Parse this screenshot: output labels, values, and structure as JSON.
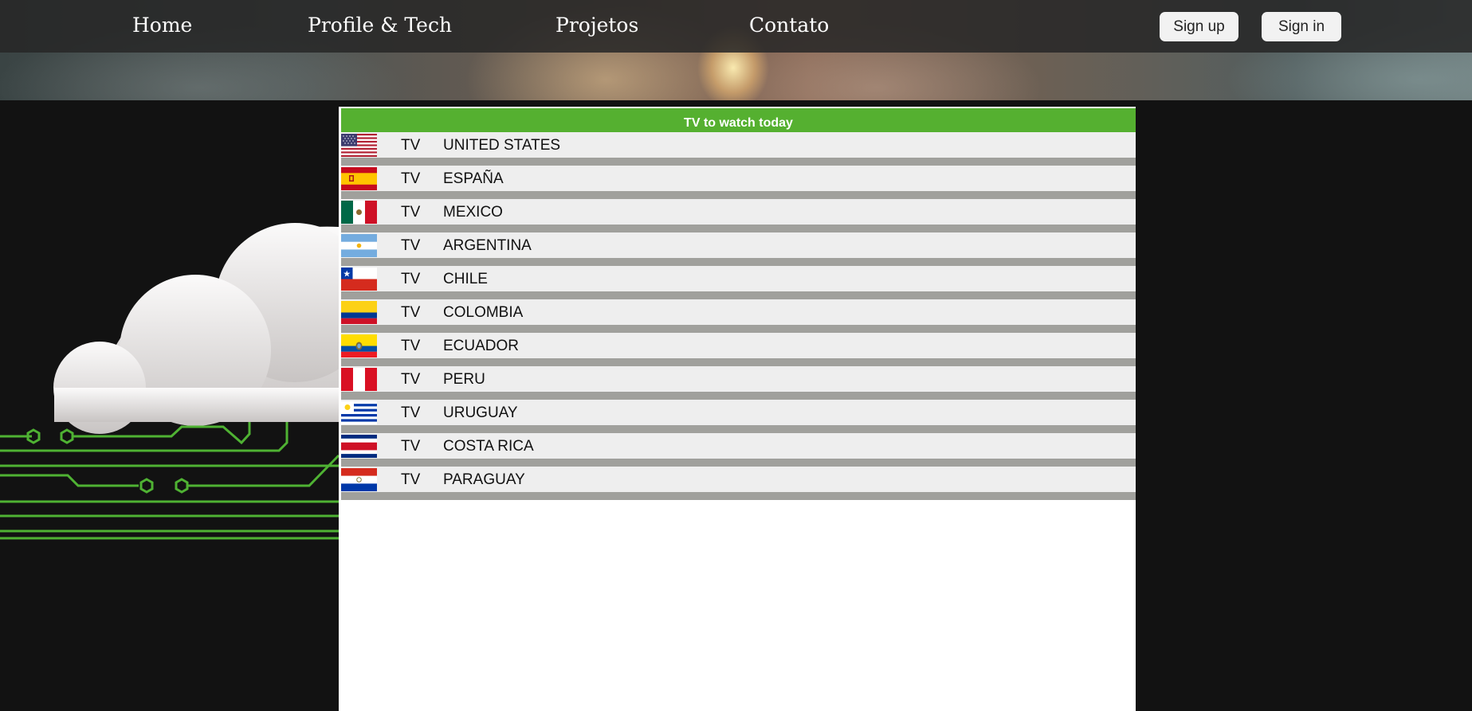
{
  "nav": {
    "links": [
      "Home",
      "Profile & Tech",
      "Projetos",
      "Contato"
    ],
    "signup_label": "Sign up",
    "signin_label": "Sign in"
  },
  "table": {
    "title": "TV to watch today",
    "rows": [
      {
        "channel": "TV",
        "country": "UNITED STATES",
        "flag_icon": "us-flag-icon"
      },
      {
        "channel": "TV",
        "country": "ESPAÑA",
        "flag_icon": "spain-flag-icon"
      },
      {
        "channel": "TV",
        "country": "MEXICO",
        "flag_icon": "mexico-flag-icon"
      },
      {
        "channel": "TV",
        "country": "ARGENTINA",
        "flag_icon": "argentina-flag-icon"
      },
      {
        "channel": "TV",
        "country": "CHILE",
        "flag_icon": "chile-flag-icon"
      },
      {
        "channel": "TV",
        "country": "COLOMBIA",
        "flag_icon": "colombia-flag-icon"
      },
      {
        "channel": "TV",
        "country": "ECUADOR",
        "flag_icon": "ecuador-flag-icon"
      },
      {
        "channel": "TV",
        "country": "PERU",
        "flag_icon": "peru-flag-icon"
      },
      {
        "channel": "TV",
        "country": "URUGUAY",
        "flag_icon": "uruguay-flag-icon"
      },
      {
        "channel": "TV",
        "country": "COSTA RICA",
        "flag_icon": "costa-rica-flag-icon"
      },
      {
        "channel": "TV",
        "country": "PARAGUAY",
        "flag_icon": "paraguay-flag-icon"
      }
    ]
  },
  "colors": {
    "accent_green": "#55b030",
    "row_background": "#eeeeee",
    "row_separator": "#a0a09c",
    "page_background": "#121212"
  }
}
